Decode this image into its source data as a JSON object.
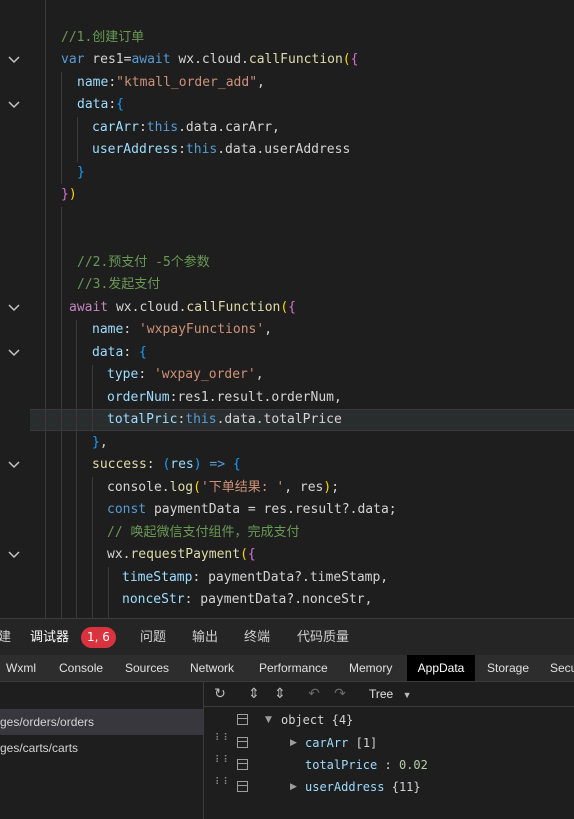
{
  "editor": {
    "lines": [
      {
        "tokens": [
          [
            "cm",
            "//1.创建订单"
          ]
        ]
      },
      {
        "tokens": [
          [
            "kw",
            "var"
          ],
          [
            "plain",
            " res1="
          ],
          [
            "kw",
            "await"
          ],
          [
            "plain",
            " wx.cloud."
          ],
          [
            "fn",
            "callFunction"
          ],
          [
            "br",
            "("
          ],
          [
            "br2",
            "{"
          ]
        ]
      },
      {
        "tokens": [
          [
            "prop",
            "name"
          ],
          [
            "plain",
            ":"
          ],
          [
            "str",
            "\"ktmall_order_add\""
          ],
          [
            "plain",
            ","
          ]
        ]
      },
      {
        "tokens": [
          [
            "prop",
            "data"
          ],
          [
            "plain",
            ":"
          ],
          [
            "br3",
            "{"
          ]
        ]
      },
      {
        "tokens": [
          [
            "prop",
            "carArr"
          ],
          [
            "plain",
            ":"
          ],
          [
            "kw",
            "this"
          ],
          [
            "plain",
            ".data.carArr,"
          ]
        ]
      },
      {
        "tokens": [
          [
            "prop",
            "userAddress"
          ],
          [
            "plain",
            ":"
          ],
          [
            "kw",
            "this"
          ],
          [
            "plain",
            ".data.userAddress"
          ]
        ]
      },
      {
        "tokens": [
          [
            "br3",
            "}"
          ]
        ]
      },
      {
        "tokens": [
          [
            "br2",
            "}"
          ],
          [
            "br",
            ")"
          ]
        ]
      },
      {
        "tokens": []
      },
      {
        "tokens": []
      },
      {
        "tokens": [
          [
            "cm",
            "//2.预支付 -5个参数"
          ]
        ]
      },
      {
        "tokens": [
          [
            "cm",
            "//3.发起支付"
          ]
        ]
      },
      {
        "tokens": [
          [
            "kw2",
            "await"
          ],
          [
            "plain",
            " wx.cloud."
          ],
          [
            "fn",
            "callFunction"
          ],
          [
            "br",
            "("
          ],
          [
            "br2",
            "{"
          ]
        ]
      },
      {
        "tokens": [
          [
            "prop",
            "name"
          ],
          [
            "plain",
            ": "
          ],
          [
            "str",
            "'wxpayFunctions'"
          ],
          [
            "plain",
            ","
          ]
        ]
      },
      {
        "tokens": [
          [
            "prop",
            "data"
          ],
          [
            "plain",
            ": "
          ],
          [
            "br3",
            "{"
          ]
        ]
      },
      {
        "tokens": [
          [
            "prop",
            "type"
          ],
          [
            "plain",
            ": "
          ],
          [
            "str",
            "'wxpay_order'"
          ],
          [
            "plain",
            ","
          ]
        ]
      },
      {
        "tokens": [
          [
            "prop",
            "orderNum"
          ],
          [
            "plain",
            ":res1.result.orderNum,"
          ]
        ]
      },
      {
        "tokens": [
          [
            "prop",
            "totalPric"
          ],
          [
            "plain",
            ":"
          ],
          [
            "kw",
            "this"
          ],
          [
            "plain",
            ".data.totalPrice"
          ]
        ]
      },
      {
        "tokens": [
          [
            "br3",
            "}"
          ],
          [
            "plain",
            ","
          ]
        ]
      },
      {
        "tokens": [
          [
            "fn",
            "success"
          ],
          [
            "plain",
            ": "
          ],
          [
            "br3",
            "("
          ],
          [
            "pname",
            "res"
          ],
          [
            "br3",
            ")"
          ],
          [
            "kw",
            " =>"
          ],
          [
            "plain",
            " "
          ],
          [
            "br3",
            "{"
          ]
        ]
      },
      {
        "tokens": [
          [
            "plain",
            "console."
          ],
          [
            "fn",
            "log"
          ],
          [
            "br",
            "("
          ],
          [
            "str",
            "'下单结果: '"
          ],
          [
            "plain",
            ", res"
          ],
          [
            "br",
            ")"
          ],
          [
            "plain",
            ";"
          ]
        ]
      },
      {
        "tokens": [
          [
            "kw",
            "const"
          ],
          [
            "plain",
            " paymentData = res.result?.data;"
          ]
        ]
      },
      {
        "tokens": [
          [
            "cm",
            "// 唤起微信支付组件，完成支付"
          ]
        ]
      },
      {
        "tokens": [
          [
            "plain",
            "wx."
          ],
          [
            "fn",
            "requestPayment"
          ],
          [
            "br",
            "("
          ],
          [
            "br2",
            "{"
          ]
        ]
      },
      {
        "tokens": [
          [
            "prop",
            "timeStamp"
          ],
          [
            "plain",
            ": paymentData?.timeStamp,"
          ]
        ]
      },
      {
        "tokens": [
          [
            "prop",
            "nonceStr"
          ],
          [
            "plain",
            ": paymentData?.nonceStr,"
          ]
        ]
      }
    ]
  },
  "devtools": {
    "main_tabs": [
      "建",
      "调试器",
      "问题",
      "输出",
      "终端",
      "代码质量"
    ],
    "badge": "1, 6",
    "sub_tabs": [
      "Wxml",
      "Console",
      "Sources",
      "Network",
      "Performance",
      "Memory",
      "AppData",
      "Storage",
      "Secu"
    ],
    "active_sub_tab": "AppData",
    "pages": [
      "ges/orders/orders",
      "ges/carts/carts"
    ],
    "toolbar_mode": "Tree",
    "tree": {
      "root_label": "object",
      "root_count": "{4}",
      "rows": [
        {
          "key": "carArr",
          "value": "[1]"
        },
        {
          "key": "totalPrice",
          "value": "0.02"
        },
        {
          "key": "userAddress",
          "value": "{11}"
        }
      ]
    }
  }
}
